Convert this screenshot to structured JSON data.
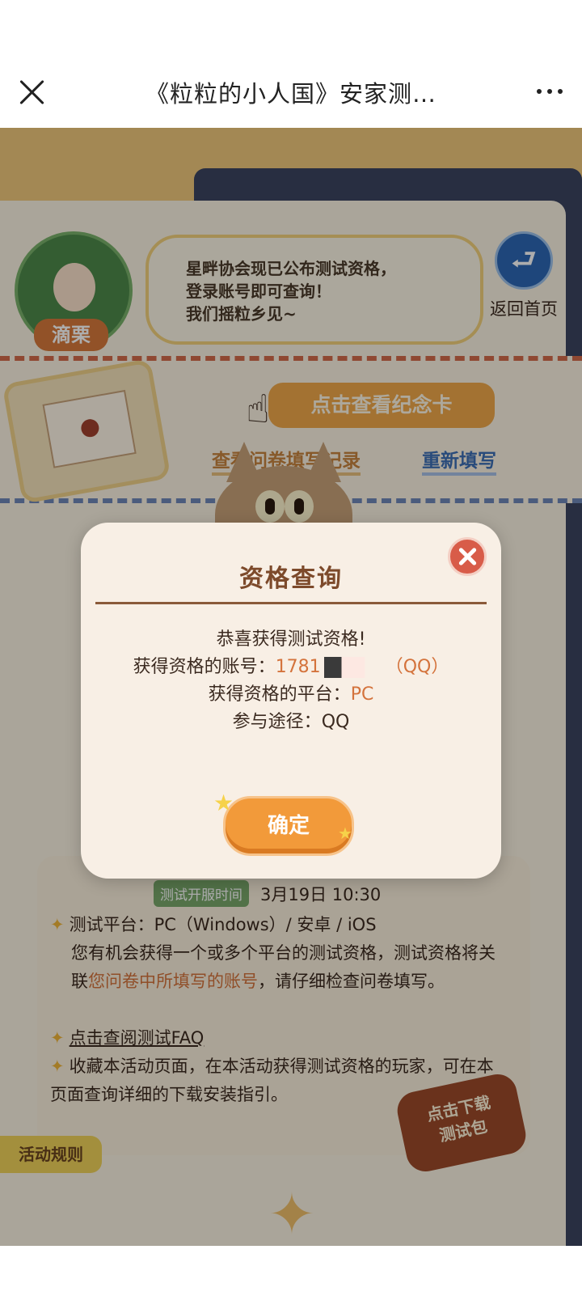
{
  "topbar": {
    "title": "《粒粒的小人国》安家测…"
  },
  "bg": {
    "npc_name": "滴栗",
    "speech_text": "星畔协会现已公布测试资格，\n登录账号即可查询！\n我们摇粒乡见~",
    "back_home_label": "返回首页",
    "memorial_button": "点击查看纪念卡",
    "survey_record_link": "查看问卷填写记录",
    "refill_link": "重新填写",
    "server_time_badge": "测试开服时间",
    "server_time_value": "3月19日 10:30",
    "rules": [
      "测试平台：PC（Windows）/ 安卓 / iOS",
      "您有机会获得一个或多个平台的测试资格，测试资格将关联",
      "您问卷中所填写的账号",
      "，请仔细检查问卷填写。",
      "点击查阅测试FAQ",
      "收藏本活动页面，在本活动获得测试资格的玩家，可在本页面查询详细的下载安装指引。"
    ],
    "rules_tab": "活动规则",
    "download_badge": "点击下载\n测试包"
  },
  "modal": {
    "title": "资格查询",
    "congrats": "恭喜获得测试资格!",
    "account_label": "获得资格的账号：",
    "account_value": "1781",
    "account_suffix": "（QQ）",
    "platform_label": "获得资格的平台：",
    "platform_value": "PC",
    "route_label": "参与途径：",
    "route_value": "QQ",
    "confirm_button": "确定"
  },
  "colors": {
    "accent": "#d4733c",
    "title_brown": "#7d4a2b",
    "button_orange": "#f29a3a",
    "close_red": "#d85c49"
  }
}
